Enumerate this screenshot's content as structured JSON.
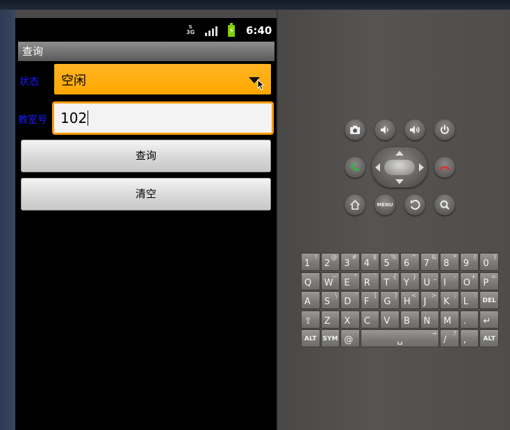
{
  "status_bar": {
    "network": "3G",
    "time": "6:40",
    "battery_color": "#7fd000"
  },
  "app": {
    "title": "查询",
    "status_label": "状态",
    "status_value": "空闲",
    "room_label": "教室号",
    "room_value": "102",
    "query_button": "查询",
    "clear_button": "清空",
    "accent": "#ffa800",
    "label_color": "#1a1aff"
  },
  "hardware_buttons": [
    {
      "name": "camera-icon"
    },
    {
      "name": "volume-down-icon"
    },
    {
      "name": "volume-up-icon"
    },
    {
      "name": "power-icon"
    },
    {
      "name": "call-icon"
    },
    {
      "name": "end-call-icon"
    },
    {
      "name": "home-icon"
    },
    {
      "name": "menu-button",
      "label": "MENU"
    },
    {
      "name": "back-icon"
    },
    {
      "name": "search-icon"
    }
  ],
  "keyboard": {
    "rows": [
      [
        {
          "main": "1",
          "alt": "!"
        },
        {
          "main": "2",
          "alt": "@"
        },
        {
          "main": "3",
          "alt": "#"
        },
        {
          "main": "4",
          "alt": "$"
        },
        {
          "main": "5",
          "alt": "%"
        },
        {
          "main": "6",
          "alt": "^"
        },
        {
          "main": "7",
          "alt": "&"
        },
        {
          "main": "8",
          "alt": "*"
        },
        {
          "main": "9",
          "alt": "("
        },
        {
          "main": "0",
          "alt": ")"
        }
      ],
      [
        {
          "main": "Q",
          "alt": ""
        },
        {
          "main": "W",
          "alt": "~"
        },
        {
          "main": "E",
          "alt": "\""
        },
        {
          "main": "R",
          "alt": "`"
        },
        {
          "main": "T",
          "alt": "{"
        },
        {
          "main": "Y",
          "alt": "}"
        },
        {
          "main": "U",
          "alt": "_"
        },
        {
          "main": "I",
          "alt": "-"
        },
        {
          "main": "O",
          "alt": "+"
        },
        {
          "main": "P",
          "alt": "="
        }
      ],
      [
        {
          "main": "A",
          "alt": ""
        },
        {
          "main": "S",
          "alt": "\\"
        },
        {
          "main": "D",
          "alt": "'"
        },
        {
          "main": "F",
          "alt": "["
        },
        {
          "main": "G",
          "alt": "]"
        },
        {
          "main": "H",
          "alt": "<"
        },
        {
          "main": "J",
          "alt": ">"
        },
        {
          "main": "K",
          "alt": ";"
        },
        {
          "main": "L",
          "alt": ":"
        },
        {
          "main": "",
          "alt": "",
          "small": "DEL"
        }
      ],
      [
        {
          "main": "⇧",
          "alt": ""
        },
        {
          "main": "Z",
          "alt": ""
        },
        {
          "main": "X",
          "alt": ""
        },
        {
          "main": "C",
          "alt": ""
        },
        {
          "main": "V",
          "alt": ""
        },
        {
          "main": "B",
          "alt": ""
        },
        {
          "main": "N",
          "alt": ""
        },
        {
          "main": "M",
          "alt": ""
        },
        {
          "main": ".",
          "alt": ""
        },
        {
          "main": "↵",
          "alt": ""
        }
      ]
    ],
    "bottom_row": [
      {
        "small": "ALT",
        "w": 1
      },
      {
        "small": "SYM",
        "w": 1
      },
      {
        "main": "@",
        "w": 1
      },
      {
        "main": "␣",
        "alt": "→",
        "w": 4
      },
      {
        "main": "/",
        "alt": "?",
        "w": 1
      },
      {
        "main": ",",
        "w": 1
      },
      {
        "small": "ALT",
        "w": 1
      }
    ]
  }
}
